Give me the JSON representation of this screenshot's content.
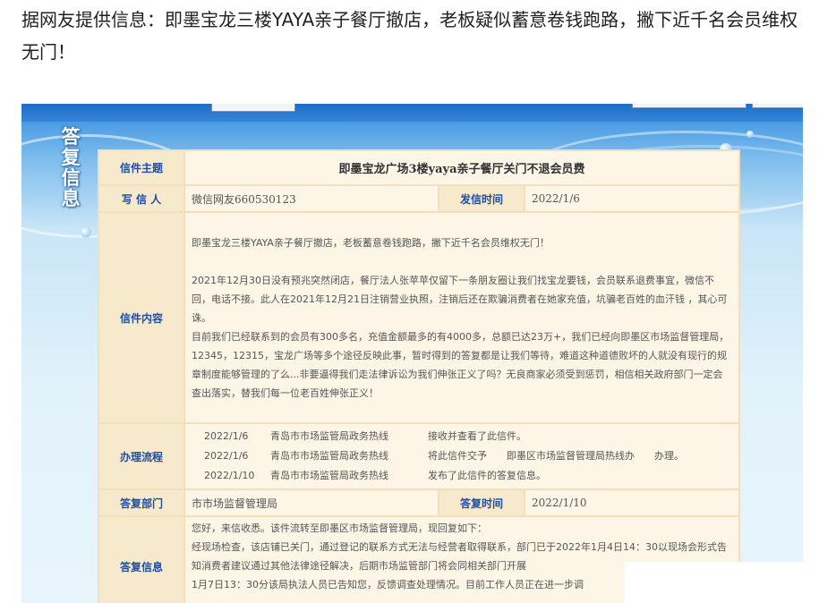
{
  "headline": "据网友提供信息：即墨宝龙三楼YAYA亲子餐厅撤店，老板疑似蓄意卷钱跑路，撇下近千名会员维权无门！",
  "sidebar_title": "答复信息",
  "letter": {
    "subject_label": "信件主题",
    "subject": "即墨宝龙广场3楼yaya亲子餐厅关门不退会员费",
    "writer_label": "写 信 人",
    "writer": "微信网友660530123",
    "sent_time_label": "发信时间",
    "sent_time": "2022/1/6",
    "content_label": "信件内容",
    "content_paragraphs": [
      "即墨宝龙三楼YAYA亲子餐厅撤店，老板蓄意卷钱跑路，撇下近千名会员维权无门！",
      "",
      "2021年12月30日没有预兆突然闭店，餐厅法人张苹苹仅留下一条朋友圈让我们找宝龙要钱，会员联系退费事宜，微信不回，电话不接。此人在2021年12月21日注销营业执照，注销后还在欺骗消费者在她家充值，坑骗老百姓的血汗钱 ，其心可诛。",
      "目前我们已经联系到的会员有300多名，充值金额最多的有4000多，总额已达23万+，我们已经向即墨区市场监督管理局，12345，12315，宝龙广场等多个途径反映此事，暂时得到的答复都是让我们等待，难道这种道德败坏的人就没有现行的规章制度能够管理的了么...非要逼得我们走法律诉讼为我们伸张正义了吗？无良商家必须受到惩罚，相信相关政府部门一定会查出落实，替我们每一位老百姓伸张正义！"
    ],
    "process_label": "办理流程",
    "process": [
      {
        "date": "2022/1/6",
        "org": "青岛市市场监管局政务热线",
        "action": "接收并查看了此信件。"
      },
      {
        "date": "2022/1/6",
        "org": "青岛市市场监管局政务热线",
        "action": "将此信件交予　　即墨区市场监督管理局热线办　　办理。"
      },
      {
        "date": "2022/1/10",
        "org": "青岛市市场监管局政务热线",
        "action": "发布了此信件的答复信息。"
      }
    ],
    "reply_dept_label": "答复部门",
    "reply_dept": "市市场监督管理局",
    "reply_time_label": "答复时间",
    "reply_time": "2022/1/10",
    "reply_label": "答复信息",
    "reply_lines": [
      "您好，来信收悉。该件流转至即墨区市场监督管理局，现回复如下：",
      "经现场检查，该店铺已关门，通过登记的联系方式无法与经营者取得联系，部门已于2022年1月4日14：30以现场会形式告知消费者建议通过其他法律途径解决，后期市场监管部门将会同相关部门开展",
      "1月7日13：30分该局执法人员已告知您，反馈调查处理情况。目前工作人员正在进一步调"
    ]
  }
}
